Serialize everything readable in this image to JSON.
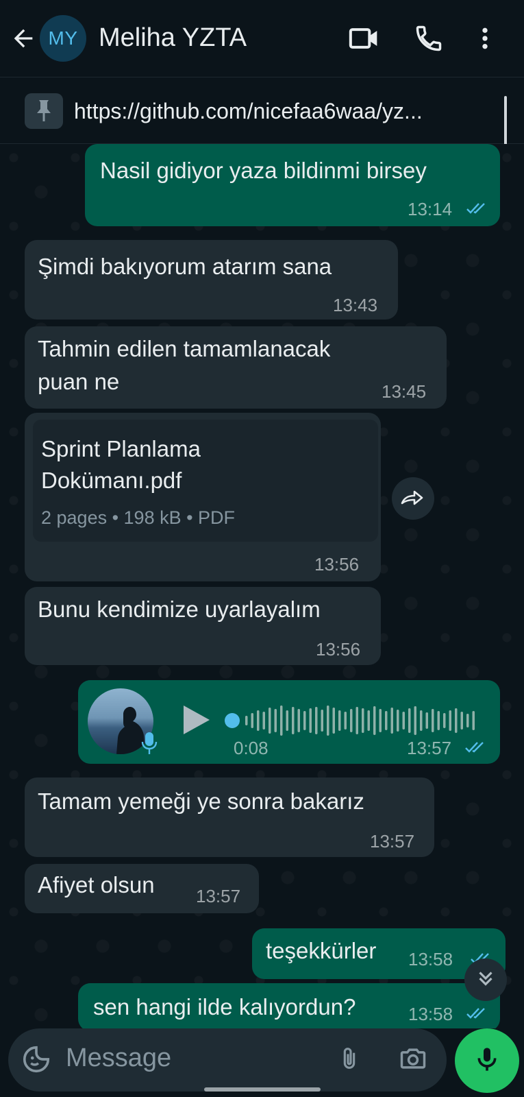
{
  "header": {
    "back_icon": "arrow-left-icon",
    "avatar_initials": "MY",
    "contact_name": "Meliha YZTA",
    "video_icon": "video-camera-icon",
    "call_icon": "phone-icon",
    "menu_icon": "more-vertical-icon"
  },
  "pinned": {
    "icon": "pin-icon",
    "text": "https://github.com/nicefaa6waa/yz..."
  },
  "messages": [
    {
      "direction": "out",
      "text": "Nasil gidiyor yaza bildinmi birsey",
      "time": "13:14",
      "status": "read"
    },
    {
      "direction": "in",
      "text": "Şimdi bakıyorum atarım sana",
      "time": "13:43"
    },
    {
      "direction": "in",
      "text_line1": "Tahmin edilen tamamlanacak",
      "text_line2": "puan ne",
      "time": "13:45"
    },
    {
      "direction": "in",
      "type": "document",
      "name_line1": "Sprint Planlama",
      "name_line2": "Dokümanı.pdf",
      "meta": "2 pages • 198 kB • PDF",
      "time": "13:56"
    },
    {
      "direction": "in",
      "text": "Bunu kendimize uyarlayalım",
      "time": "13:56"
    },
    {
      "direction": "out",
      "type": "voice",
      "duration": "0:08",
      "time": "13:57",
      "status": "read"
    },
    {
      "direction": "in",
      "text": "Tamam yemeği ye sonra bakarız",
      "time": "13:57"
    },
    {
      "direction": "in",
      "text": "Afiyet olsun",
      "time": "13:57"
    },
    {
      "direction": "out",
      "text": "teşekkürler",
      "time": "13:58",
      "status": "read"
    },
    {
      "direction": "out",
      "text": "sen hangi ilde kalıyordun?",
      "time": "13:58",
      "status": "read"
    }
  ],
  "composer": {
    "placeholder": "Message",
    "emoji_icon": "sticker-smiley-icon",
    "attach_icon": "paperclip-icon",
    "camera_icon": "camera-icon",
    "mic_icon": "microphone-icon"
  },
  "colors": {
    "background": "#0b141a",
    "incoming_bubble": "#202c33",
    "outgoing_bubble": "#005c4b",
    "read_ticks": "#53bdeb",
    "mic_button": "#21c063"
  }
}
